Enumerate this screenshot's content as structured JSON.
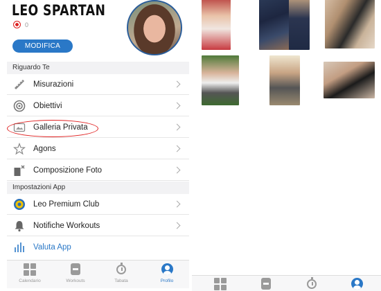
{
  "profile": {
    "name": "LEO SPARTAN",
    "badge_count": "0",
    "edit_button": "MODIFICA"
  },
  "sections": {
    "about": "Riguardo Te",
    "app_settings": "Impostazioni App"
  },
  "menu": {
    "misurazioni": {
      "label": "Misurazioni",
      "icon": "ruler-icon"
    },
    "obiettivi": {
      "label": "Obiettivi",
      "icon": "target-icon"
    },
    "galleria": {
      "label": "Galleria Privata",
      "icon": "gallery-icon"
    },
    "agons": {
      "label": "Agons",
      "icon": "star-icon"
    },
    "composizione": {
      "label": "Composizione Foto",
      "icon": "photo-compose-icon"
    },
    "premium": {
      "label": "Leo Premium Club",
      "icon": "premium-club-icon"
    },
    "notifiche": {
      "label": "Notifiche Workouts",
      "icon": "bell-icon"
    },
    "valuta": {
      "label": "Valuta App",
      "icon": "rating-icon"
    }
  },
  "tabs": [
    {
      "label": "Calendario",
      "icon": "grid-icon"
    },
    {
      "label": "Workouts",
      "icon": "workout-icon"
    },
    {
      "label": "Tabata",
      "icon": "timer-icon"
    },
    {
      "label": "Profilo",
      "icon": "profile-icon"
    }
  ],
  "colors": {
    "accent": "#2a78c7",
    "highlight": "#e02020",
    "section_bg": "#f2f2f4"
  }
}
